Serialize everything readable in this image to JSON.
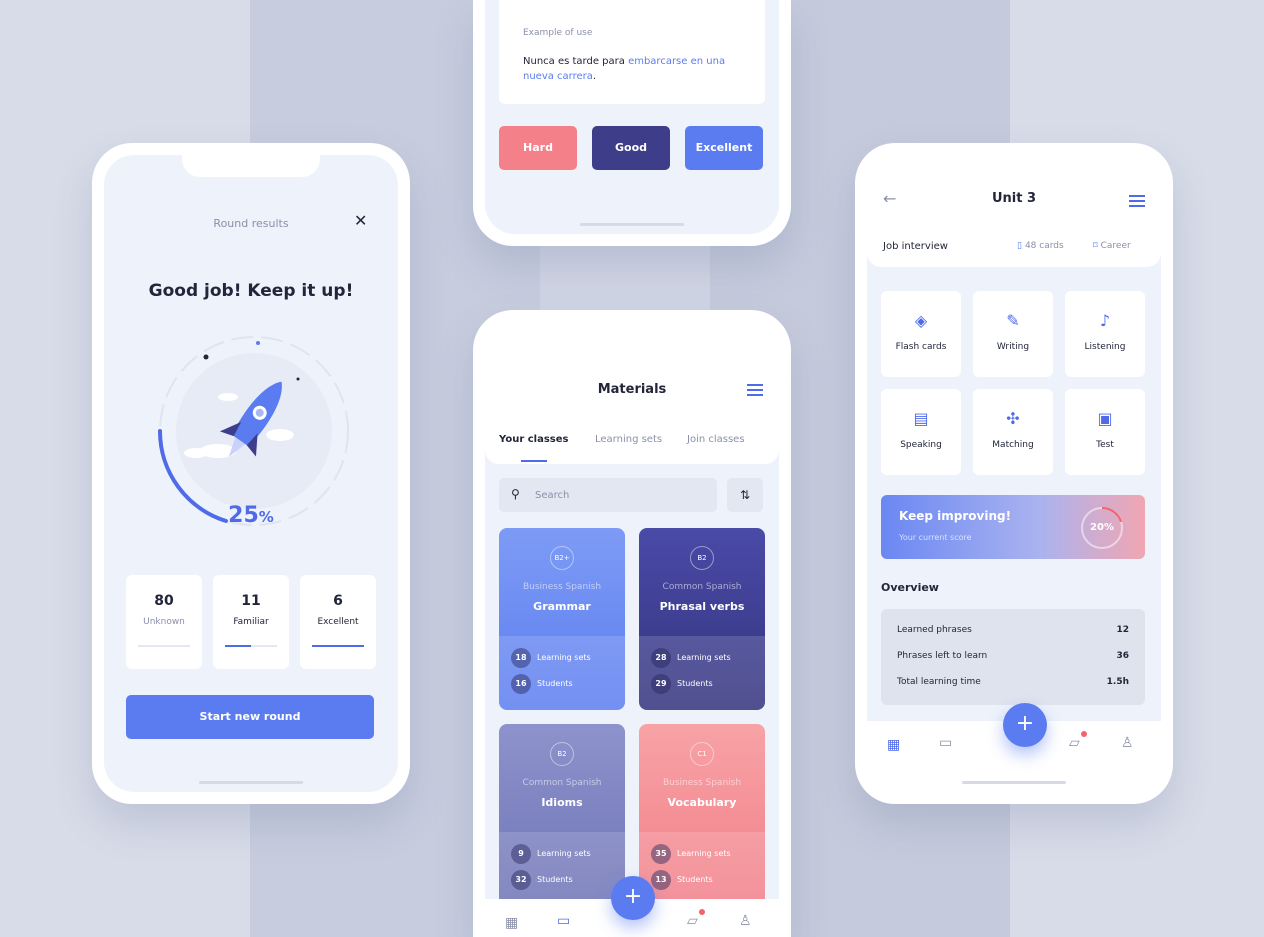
{
  "colors": {
    "accent": "#5b7cf0",
    "dark": "#23263a",
    "hard": "#f4808a",
    "good": "#3d3d8a",
    "excellent": "#5b7cf0"
  },
  "results": {
    "title": "Round results",
    "headline": "Good job! Keep it up!",
    "progress": {
      "value": "25",
      "unit": "%"
    },
    "stats": [
      {
        "value": "80",
        "label": "Unknown",
        "fill": 0
      },
      {
        "value": "11",
        "label": "Familiar",
        "fill": 0.5
      },
      {
        "value": "6",
        "label": "Excellent",
        "fill": 1
      }
    ],
    "start_label": "Start new round"
  },
  "example": {
    "label": "Example of use",
    "text_plain": "Nunca es tarde para ",
    "text_highlight": "embarcarse en una nueva carrera",
    "text_end": ".",
    "buttons": {
      "hard": "Hard",
      "good": "Good",
      "excellent": "Excellent"
    }
  },
  "materials": {
    "title": "Materials",
    "tabs": [
      "Your classes",
      "Learning sets",
      "Join classes"
    ],
    "search_placeholder": "Search",
    "classes": [
      {
        "level": "B2+",
        "subtitle": "Business Spanish",
        "name": "Grammar",
        "sets": "18",
        "sets_label": "Learning sets",
        "students": "16",
        "students_label": "Students",
        "color_top": "#7d9bf5",
        "color_bottom": "#5d7ef0"
      },
      {
        "level": "B2",
        "subtitle": "Common Spanish",
        "name": "Phrasal verbs",
        "sets": "28",
        "sets_label": "Learning sets",
        "students": "29",
        "students_label": "Students",
        "color_top": "#4a4aa8",
        "color_bottom": "#34347e"
      },
      {
        "level": "B2",
        "subtitle": "Common Spanish",
        "name": "Idioms",
        "sets": "9",
        "sets_label": "Learning sets",
        "students": "32",
        "students_label": "Students",
        "color_top": "#8e93cc",
        "color_bottom": "#6f74b6"
      },
      {
        "level": "C1",
        "subtitle": "Business Spanish",
        "name": "Vocabulary",
        "sets": "35",
        "sets_label": "Learning sets",
        "students": "13",
        "students_label": "Students",
        "color_top": "#f7a3a6",
        "color_bottom": "#f27f89"
      }
    ]
  },
  "unit": {
    "title": "Unit 3",
    "topic": "Job interview",
    "cards": "48 cards",
    "category": "Career",
    "activities": [
      "Flash cards",
      "Writing",
      "Listening",
      "Speaking",
      "Matching",
      "Test"
    ],
    "banner": {
      "title": "Keep improving!",
      "subtitle": "Your current score",
      "score": "20%",
      "score_value": 0.2
    },
    "overview": {
      "title": "Overview",
      "rows": [
        {
          "label": "Learned phrases",
          "value": "12"
        },
        {
          "label": "Phrases left to learn",
          "value": "36"
        },
        {
          "label": "Total learning time",
          "value": "1.5h"
        }
      ]
    }
  }
}
